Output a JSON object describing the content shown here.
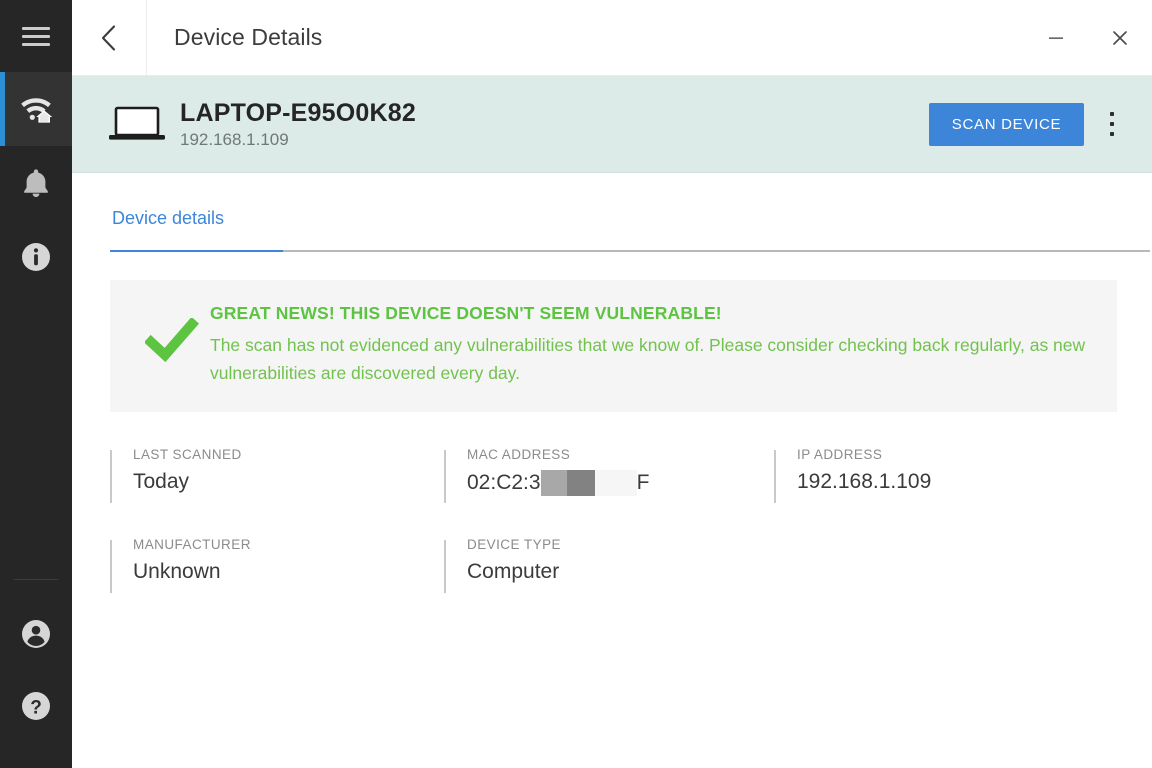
{
  "sidebar": {
    "menu_icon": "hamburger-menu-icon",
    "items": [
      {
        "icon": "wifi-home-icon",
        "name": "network",
        "active": true
      },
      {
        "icon": "bell-icon",
        "name": "notifications",
        "active": false
      },
      {
        "icon": "info-circle-icon",
        "name": "info",
        "active": false
      }
    ],
    "bottom_items": [
      {
        "icon": "user-account-icon",
        "name": "account"
      },
      {
        "icon": "help-question-icon",
        "name": "help"
      }
    ],
    "accent_color": "#2d8fd5",
    "background_color": "#262626"
  },
  "titlebar": {
    "back_icon": "chevron-left-icon",
    "title": "Device Details",
    "minimize_icon": "minimize-icon",
    "close_icon": "close-icon"
  },
  "device_header": {
    "icon": "laptop-icon",
    "name": "LAPTOP-E95O0K82",
    "ip": "192.168.1.109",
    "scan_button_label": "SCAN DEVICE",
    "scan_button_color": "#3d85d8",
    "overflow_icon": "kebab-menu-icon",
    "background_color": "#dcebe8"
  },
  "tabs": [
    {
      "label": "Device details",
      "active": true
    }
  ],
  "status_banner": {
    "icon": "green-checkmark-icon",
    "title": "GREAT NEWS! THIS DEVICE DOESN'T SEEM VULNERABLE!",
    "text": "The scan has not evidenced any vulnerabilities that we know of. Please consider checking back regularly, as new vulnerabilities are discovered every day.",
    "title_color": "#5cc441",
    "text_color": "#72c24f",
    "background_color": "#f5f5f5"
  },
  "details": {
    "row1": [
      {
        "label": "LAST SCANNED",
        "value": "Today"
      },
      {
        "label": "MAC ADDRESS",
        "value_prefix": "02:C2:3",
        "value_suffix": "F",
        "redacted": true
      },
      {
        "label": "IP ADDRESS",
        "value": "192.168.1.109"
      }
    ],
    "row2": [
      {
        "label": "MANUFACTURER",
        "value": "Unknown"
      },
      {
        "label": "DEVICE TYPE",
        "value": "Computer"
      }
    ]
  }
}
